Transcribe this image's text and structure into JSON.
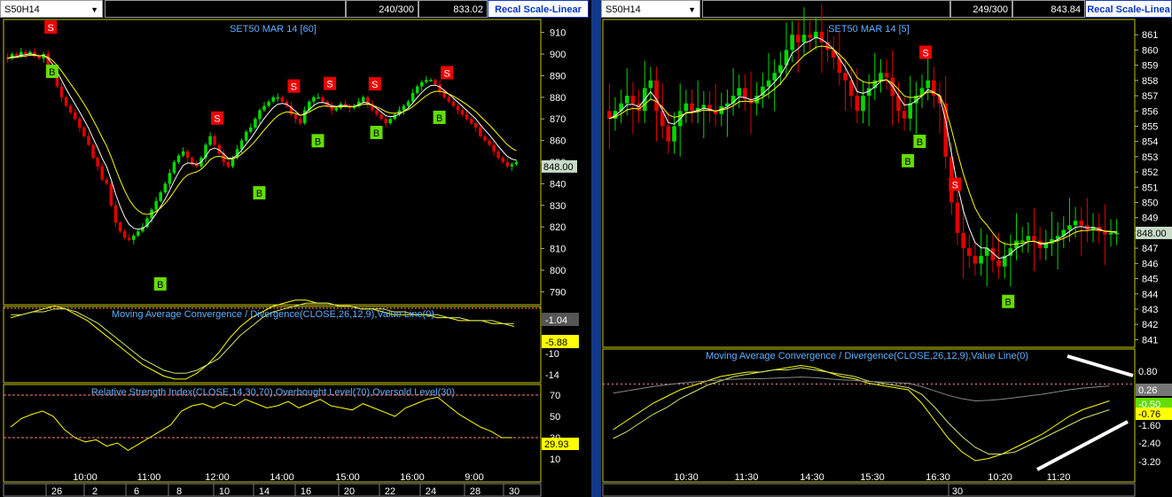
{
  "colors": {
    "background": "#000000",
    "up_candle": "#00d800",
    "down_candle": "#e00000",
    "ma_line": "#ffff00",
    "title_text": "#5fb0ff",
    "frame": "#c8c800",
    "grid": "#333333",
    "buy_marker": "#66dd00",
    "sell_marker": "#ee0000",
    "divider": "#123a8a"
  },
  "left": {
    "toolbar": {
      "symbol": "S50H14",
      "count": "240/300",
      "price": "833.02",
      "recal": "Recal Scale-Linear"
    },
    "chart_title": "SET50 MAR 14  [60]",
    "price_box": "848.00",
    "price_ticks": [
      "910",
      "900",
      "890",
      "880",
      "870",
      "860",
      "850",
      "840",
      "830",
      "820",
      "810",
      "800",
      "790"
    ],
    "macd_title": "Moving Average Convergence / Divergence(CLOSE,26,12,9),Value Line(0)",
    "macd_ticks": [
      "-1.04",
      "-5.88",
      "-10",
      "-14"
    ],
    "rsi_title": "Relative Strength Index(CLOSE,14,30,70),Overbought Level(70),Oversold Level(30)",
    "rsi_ticks": [
      "70",
      "50",
      "30",
      "10"
    ],
    "rsi_box": "29.93",
    "time_labels": [
      "10:00",
      "11:00",
      "12:00",
      "14:00",
      "15:00",
      "16:00",
      "9:00"
    ],
    "date_labels": [
      "26",
      "2",
      "6",
      "8",
      "10",
      "14",
      "16",
      "20",
      "22",
      "24",
      "28",
      "30"
    ]
  },
  "right": {
    "toolbar": {
      "symbol": "S50H14",
      "count": "249/300",
      "price": "843.84",
      "recal": "Recal Scale-Linea"
    },
    "chart_title": "SET50 MAR 14  [5]",
    "price_box": "848.00",
    "price_ticks": [
      "861",
      "860",
      "859",
      "858",
      "857",
      "856",
      "855",
      "854",
      "853",
      "852",
      "851",
      "850",
      "849",
      "848",
      "847",
      "846",
      "845",
      "844",
      "843",
      "842",
      "841"
    ],
    "macd_title": "Moving Average Convergence / Divergence(CLOSE,26,12,9),Value Line(0)",
    "macd_ticks": [
      "0.80",
      "0.26",
      "-0.50",
      "-0.76",
      "-1.60",
      "-2.40",
      "-3.20"
    ],
    "time_labels": [
      "10:30",
      "11:30",
      "14:30",
      "15:30",
      "16:30",
      "10:20",
      "11:20"
    ],
    "date_labels": [
      "30"
    ]
  },
  "chart_data": [
    {
      "type": "candlestick",
      "title": "SET50 MAR 14  [60]",
      "ylim": [
        784,
        916
      ],
      "close": [
        898,
        900,
        899,
        901,
        900,
        901,
        899,
        898,
        900,
        895,
        890,
        885,
        880,
        876,
        873,
        870,
        866,
        862,
        858,
        852,
        848,
        842,
        840,
        830,
        822,
        818,
        815,
        814,
        816,
        818,
        820,
        824,
        828,
        832,
        836,
        840,
        845,
        850,
        853,
        855,
        852,
        849,
        848,
        852,
        858,
        862,
        858,
        854,
        850,
        848,
        852,
        856,
        860,
        864,
        866,
        870,
        874,
        876,
        878,
        880,
        880,
        878,
        876,
        872,
        870,
        868,
        874,
        878,
        880,
        880,
        878,
        876,
        874,
        875,
        877,
        876,
        875,
        876,
        878,
        880,
        877,
        874,
        872,
        870,
        868,
        870,
        872,
        874,
        876,
        878,
        882,
        885,
        887,
        888,
        888,
        886,
        883,
        880,
        878,
        876,
        874,
        872,
        870,
        868,
        866,
        862,
        860,
        858,
        855,
        852,
        850,
        848,
        849,
        850
      ],
      "buy_signals": [
        "B",
        "B",
        "B",
        "B",
        "B",
        "B"
      ],
      "sell_signals": [
        "S",
        "S",
        "S",
        "S",
        "S",
        "S"
      ],
      "macd": [
        -2,
        -1,
        0,
        1,
        2,
        1,
        -1,
        -3,
        -6,
        -9,
        -12,
        -15,
        -18,
        -20,
        -22,
        -23,
        -23,
        -21,
        -18,
        -14,
        -9,
        -5,
        -2,
        0,
        2,
        3,
        4,
        4,
        3,
        3,
        2,
        2,
        1,
        1,
        0,
        -1,
        -1,
        -1,
        -1,
        -2,
        -2,
        -3,
        -3,
        -3,
        -4,
        -4,
        -5
      ],
      "macd_signal": [
        -1,
        -1,
        0,
        0,
        1,
        1,
        0,
        -2,
        -4,
        -7,
        -10,
        -13,
        -16,
        -18,
        -20,
        -21,
        -21,
        -20,
        -18,
        -16,
        -12,
        -8,
        -5,
        -2,
        0,
        1,
        2,
        3,
        3,
        3,
        2,
        2,
        1,
        1,
        1,
        0,
        0,
        -1,
        -1,
        -1,
        -2,
        -2,
        -3,
        -3,
        -3,
        -4,
        -4
      ],
      "rsi": [
        40,
        48,
        52,
        55,
        50,
        38,
        30,
        26,
        28,
        22,
        25,
        18,
        24,
        30,
        36,
        42,
        55,
        60,
        62,
        58,
        63,
        60,
        66,
        62,
        58,
        60,
        64,
        58,
        62,
        66,
        60,
        58,
        56,
        62,
        58,
        54,
        50,
        58,
        62,
        66,
        68,
        60,
        52,
        46,
        40,
        36,
        30,
        30
      ]
    },
    {
      "type": "candlestick",
      "title": "SET50 MAR 14  [5]",
      "ylim": [
        840.5,
        862
      ],
      "close": [
        855.5,
        856,
        856.5,
        857,
        856.5,
        856,
        857.5,
        858,
        856,
        855,
        854,
        855,
        856,
        856.5,
        856,
        856.2,
        856.4,
        856,
        855.8,
        856.3,
        856.5,
        857,
        857.5,
        856.8,
        856.5,
        857,
        857.6,
        858,
        858.5,
        859,
        860,
        861,
        860.5,
        861,
        860.8,
        861.2,
        860.5,
        860,
        859.5,
        858.5,
        858,
        857,
        856,
        857,
        857.5,
        858,
        858.5,
        858.2,
        857,
        856,
        855.5,
        856.5,
        857,
        857.5,
        858,
        857,
        856.5,
        853,
        850,
        848,
        847,
        846.5,
        846,
        846.5,
        847,
        846.2,
        845.8,
        846.5,
        847,
        847.5,
        847.5,
        847.8,
        847.5,
        847,
        847.3,
        847.6,
        847.8,
        848.2,
        848.5,
        848.8,
        848.5,
        848.2,
        848.4,
        848.1,
        847.9,
        848,
        848
      ],
      "buy_signals": [
        "B",
        "B",
        "B"
      ],
      "sell_signals": [
        "S",
        "S"
      ],
      "macd": [
        -1.8,
        -1.4,
        -1.0,
        -0.6,
        -0.3,
        0,
        0.2,
        0.4,
        0.6,
        0.7,
        0.8,
        0.8,
        0.9,
        1.0,
        1.1,
        1.0,
        0.8,
        0.6,
        0.5,
        0.3,
        0.2,
        0.1,
        0,
        -0.6,
        -1.4,
        -2.2,
        -2.8,
        -3.2,
        -3.1,
        -2.9,
        -2.6,
        -2.3,
        -2.0,
        -1.6,
        -1.2,
        -0.9,
        -0.7,
        -0.5
      ],
      "macd_signal": [
        -2.2,
        -1.9,
        -1.5,
        -1.1,
        -0.8,
        -0.4,
        -0.1,
        0.2,
        0.4,
        0.6,
        0.7,
        0.8,
        0.9,
        0.9,
        1.0,
        0.9,
        0.8,
        0.7,
        0.6,
        0.4,
        0.3,
        0.2,
        0.1,
        -0.2,
        -0.8,
        -1.5,
        -2.1,
        -2.6,
        -2.9,
        -2.9,
        -2.8,
        -2.5,
        -2.2,
        -1.9,
        -1.6,
        -1.3,
        -1.1,
        -0.9
      ]
    }
  ]
}
